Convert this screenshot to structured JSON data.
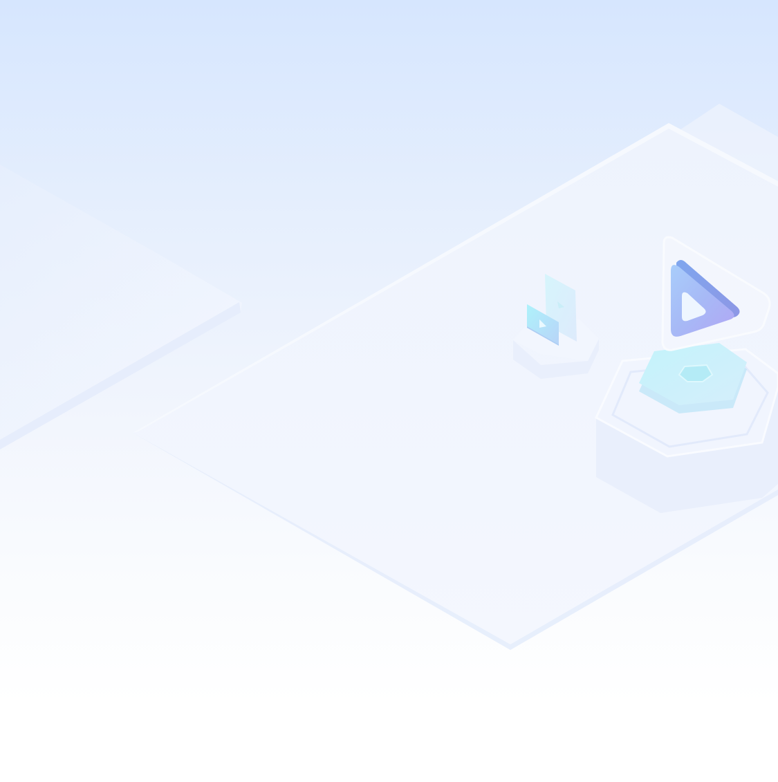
{
  "theme": {
    "sky_top": "#d6e6fe",
    "sky_bottom": "#ffffff",
    "platform_fill": "#eef3fd",
    "platform_edge": "#f6f9fe",
    "accent_cyan": "#9ff0fb",
    "accent_blue": "#93b8f7",
    "accent_violet": "#a9a8f4"
  },
  "icons": {
    "large_emblem": "play-triangle-icon",
    "small_emblem": "play-triangle-icon",
    "back_card": "play-triangle-icon"
  }
}
